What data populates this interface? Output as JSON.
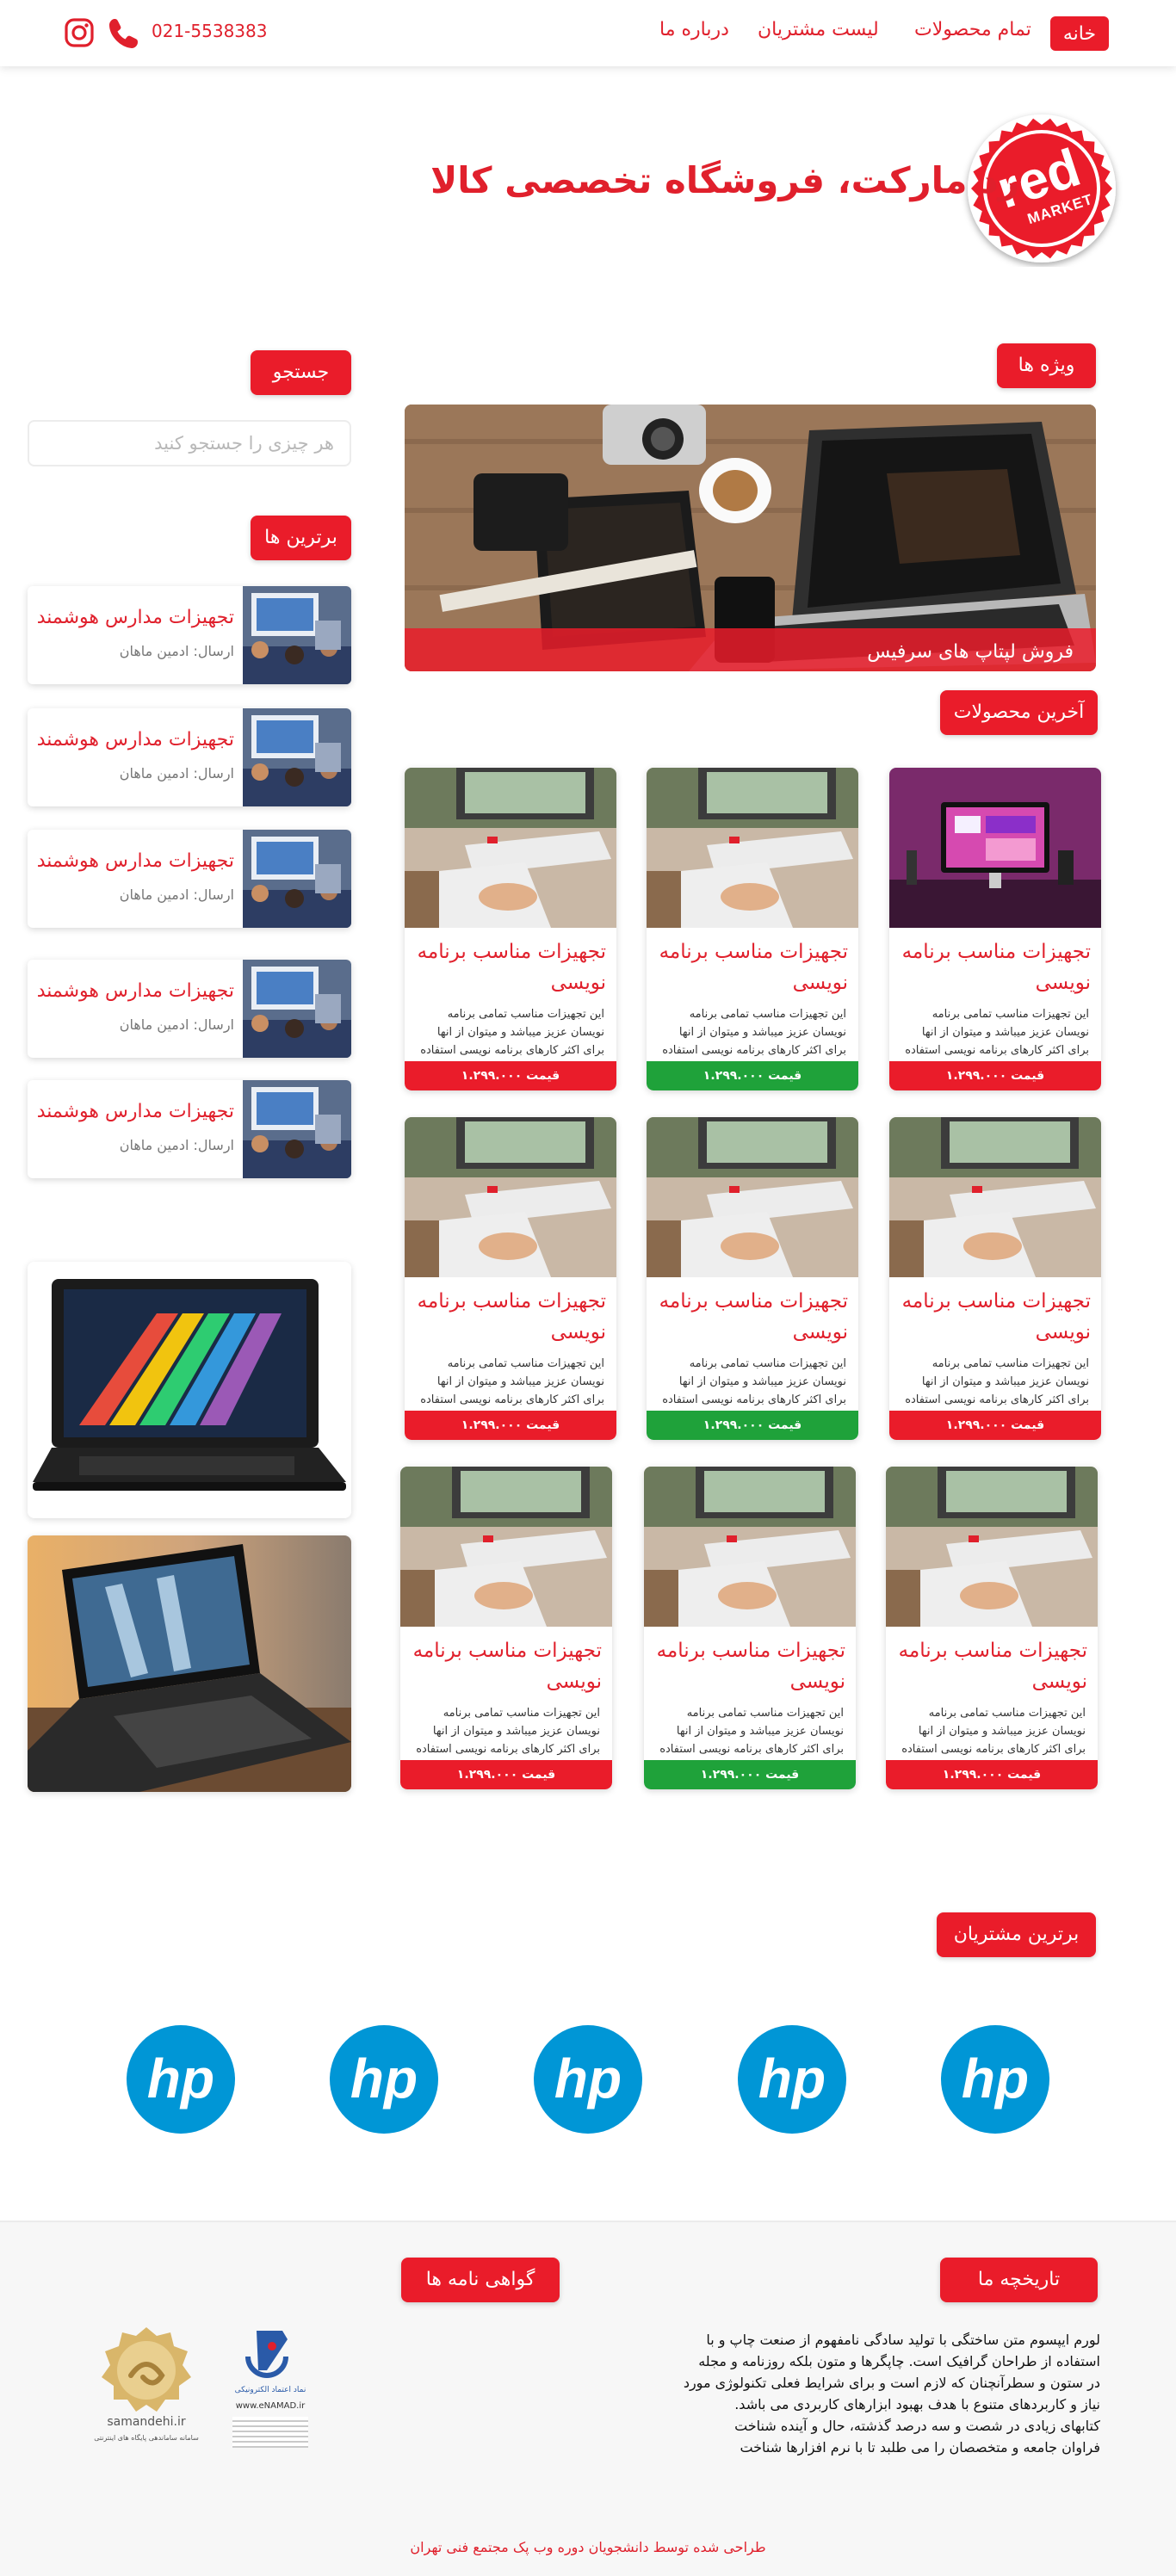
{
  "nav": {
    "links": [
      "خانه",
      "تمام محصولات",
      "لیست مشتریان",
      "درباره ما"
    ],
    "phone": "021-5538383"
  },
  "brand": {
    "logo_text": "red",
    "logo_sub": "MARKET",
    "headline": "رد مارکت، فروشگاه تخصصی کالا"
  },
  "sidebar": {
    "search_label": "جستجو",
    "search_placeholder": "هر چیزی را جستجو کنید",
    "top_label": "برترین ها",
    "top_items": [
      {
        "title": "تجهیزات مدارس هوشمند",
        "author": "ارسال: ادمین ماهان"
      },
      {
        "title": "تجهیزات مدارس هوشمند",
        "author": "ارسال: ادمین ماهان"
      },
      {
        "title": "تجهیزات مدارس هوشمند",
        "author": "ارسال: ادمین ماهان"
      },
      {
        "title": "تجهیزات مدارس هوشمند",
        "author": "ارسال: ادمین ماهان"
      },
      {
        "title": "تجهیزات مدارس هوشمند",
        "author": "ارسال: ادمین ماهان"
      }
    ]
  },
  "featured": {
    "label": "ویژه ها",
    "banner_caption": "فروش لپتاپ های سرفیس"
  },
  "latest": {
    "label": "آخرین محصولات",
    "cards": [
      {
        "title": "تجهیزات مناسب برنامه نویسی",
        "desc": "این تجهیزات مناسب تمامی برنامه نویسان عزیز میباشد و میتوان از انها برای اکثر کارهای برنامه نویسی استفاده نمود.",
        "price": "قیمت ۱.۲۹۹.۰۰۰",
        "price_color": "#ea1c2a"
      },
      {
        "title": "تجهیزات مناسب برنامه نویسی",
        "desc": "این تجهیزات مناسب تمامی برنامه نویسان عزیز میباشد و میتوان از انها برای اکثر کارهای برنامه نویسی استفاده نمود.",
        "price": "قیمت ۱.۲۹۹.۰۰۰",
        "price_color": "#1fa23a"
      },
      {
        "title": "تجهیزات مناسب برنامه نویسی",
        "desc": "این تجهیزات مناسب تمامی برنامه نویسان عزیز میباشد و میتوان از انها برای اکثر کارهای برنامه نویسی استفاده نمود.",
        "price": "قیمت ۱.۲۹۹.۰۰۰",
        "price_color": "#ea1c2a"
      },
      {
        "title": "تجهیزات مناسب برنامه نویسی",
        "desc": "این تجهیزات مناسب تمامی برنامه نویسان عزیز میباشد و میتوان از انها برای اکثر کارهای برنامه نویسی استفاده نمود.",
        "price": "قیمت ۱.۲۹۹.۰۰۰",
        "price_color": "#ea1c2a"
      },
      {
        "title": "تجهیزات مناسب برنامه نویسی",
        "desc": "این تجهیزات مناسب تمامی برنامه نویسان عزیز میباشد و میتوان از انها برای اکثر کارهای برنامه نویسی استفاده نمود.",
        "price": "قیمت ۱.۲۹۹.۰۰۰",
        "price_color": "#1fa23a"
      },
      {
        "title": "تجهیزات مناسب برنامه نویسی",
        "desc": "این تجهیزات مناسب تمامی برنامه نویسان عزیز میباشد و میتوان از انها برای اکثر کارهای برنامه نویسی استفاده نمود.",
        "price": "قیمت ۱.۲۹۹.۰۰۰",
        "price_color": "#ea1c2a"
      },
      {
        "title": "تجهیزات مناسب برنامه نویسی",
        "desc": "این تجهیزات مناسب تمامی برنامه نویسان عزیز میباشد و میتوان از انها برای اکثر کارهای برنامه نویسی استفاده نمود.",
        "price": "قیمت ۱.۲۹۹.۰۰۰",
        "price_color": "#ea1c2a"
      },
      {
        "title": "تجهیزات مناسب برنامه نویسی",
        "desc": "این تجهیزات مناسب تمامی برنامه نویسان عزیز میباشد و میتوان از انها برای اکثر کارهای برنامه نویسی استفاده نمود.",
        "price": "قیمت ۱.۲۹۹.۰۰۰",
        "price_color": "#1fa23a"
      },
      {
        "title": "تجهیزات مناسب برنامه نویسی",
        "desc": "این تجهیزات مناسب تمامی برنامه نویسان عزیز میباشد و میتوان از انها برای اکثر کارهای برنامه نویسی استفاده نمود.",
        "price": "قیمت ۱.۲۹۹.۰۰۰",
        "price_color": "#ea1c2a"
      }
    ]
  },
  "customers": {
    "label": "برترین مشتریان",
    "logo_text": "hp"
  },
  "footer": {
    "history_label": "تاریخچه ما",
    "history_lines": [
      "لورم ایپسوم متن ساختگی با تولید سادگی نامفهوم از صنعت چاپ و با",
      "استفاده از طراحان گرافیک است. چاپگرها و متون بلکه روزنامه و مجله",
      "در ستون و سطرآنچنان که لازم است و برای شرایط فعلی تکنولوژی مورد",
      "نیاز و کاربردهای متنوع با هدف بهبود ابزارهای کاربردی می باشد.",
      "کتابهای زیادی در شصت و سه درصد گذشته، حال و آینده شناخت",
      "فراوان جامعه و متخصصان را می طلبد تا با نرم افزارها شناخت"
    ],
    "certs_label": "گواهی نامه ها",
    "samandehi_url": "samandehi.ir",
    "samandehi_caption": "سامانه ساماندهی پایگاه های اینترنتی",
    "enamad_title": "نماد اعتماد الکترونیکی",
    "enamad_url": "www.eNAMAD.ir",
    "credit": "طراحی شده توسط دانشجویان دوره وب پک مجتمع فنی تهران"
  },
  "colors": {
    "brand_red": "#ea1c2a",
    "price_green": "#1fa23a",
    "hp_blue": "#0096d6"
  },
  "icons": [
    "instagram-icon",
    "phone-icon"
  ]
}
